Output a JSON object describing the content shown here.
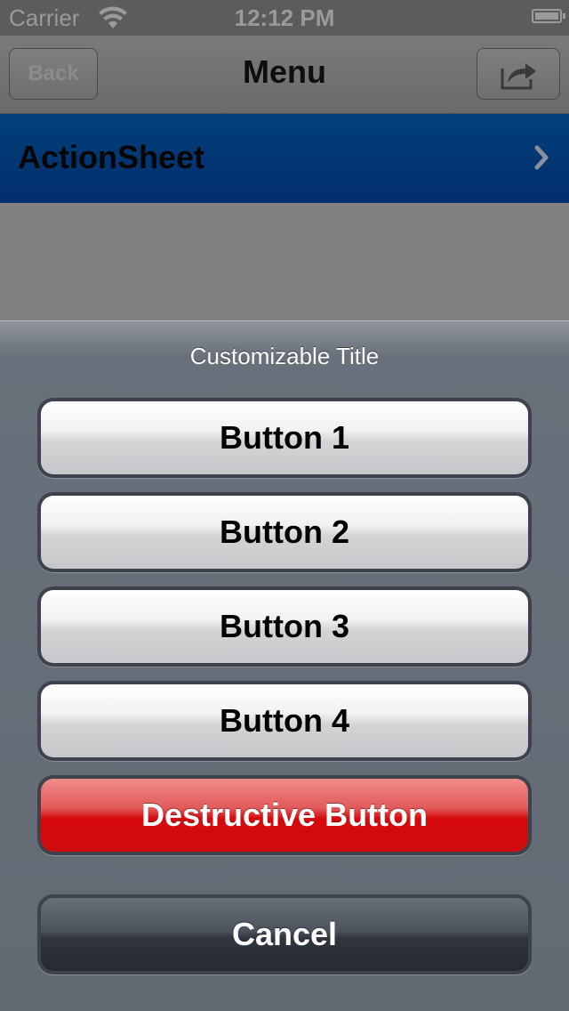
{
  "status_bar": {
    "carrier": "Carrier",
    "time": "12:12 PM",
    "wifi_icon": "wifi-icon",
    "battery_icon": "battery-icon"
  },
  "nav_bar": {
    "back_label": "Back",
    "title": "Menu",
    "action_icon": "share-icon"
  },
  "table": {
    "rows": [
      {
        "label": "ActionSheet",
        "accessory_icon": "chevron-right-icon"
      }
    ]
  },
  "action_sheet": {
    "title": "Customizable Title",
    "buttons": [
      {
        "label": "Button 1",
        "style": "default"
      },
      {
        "label": "Button 2",
        "style": "default"
      },
      {
        "label": "Button 3",
        "style": "default"
      },
      {
        "label": "Button 4",
        "style": "default"
      },
      {
        "label": "Destructive Button",
        "style": "destructive"
      }
    ],
    "cancel_label": "Cancel"
  },
  "colors": {
    "cell_highlight": "#023a78",
    "destructive": "#d6090c",
    "sheet_background": "#646a74"
  }
}
